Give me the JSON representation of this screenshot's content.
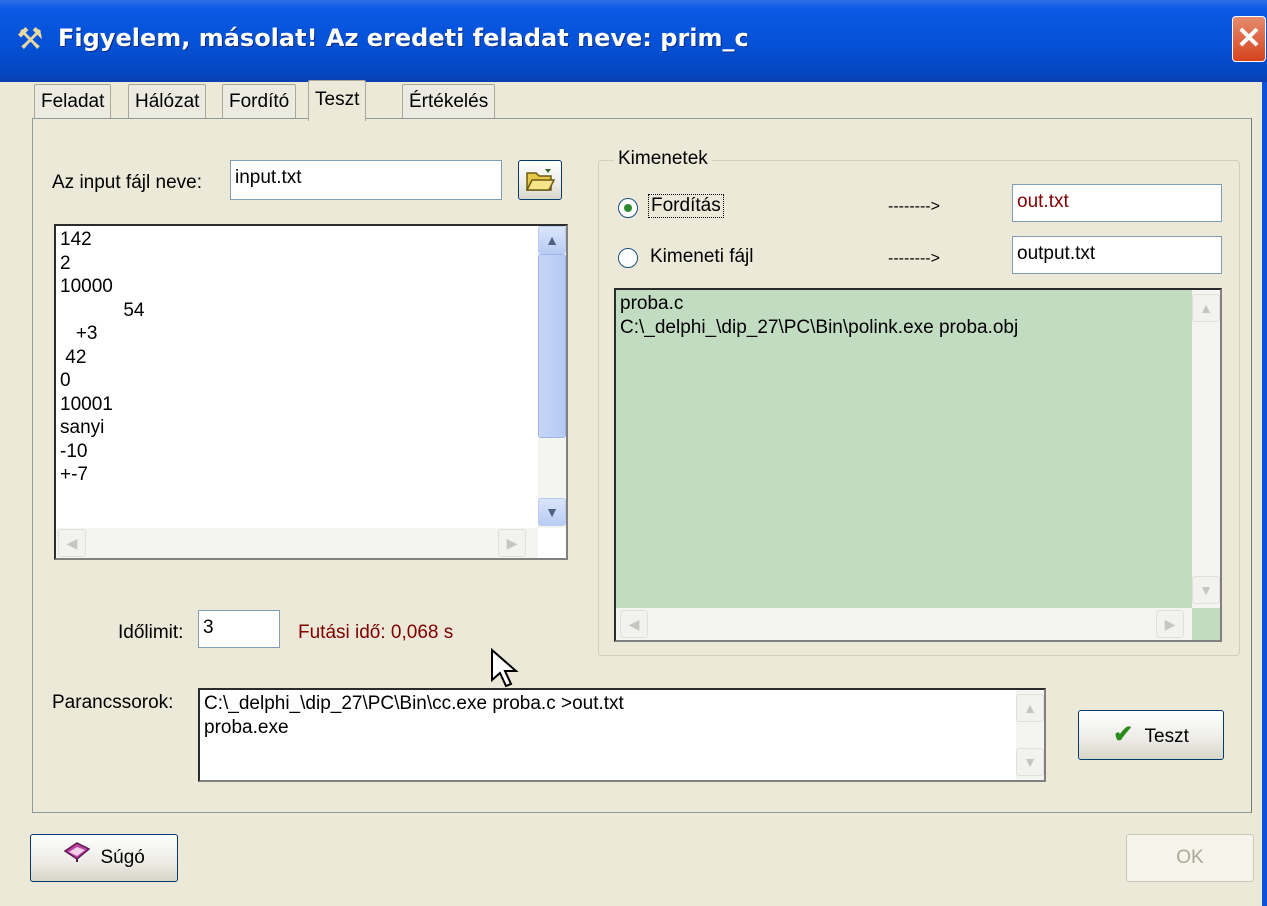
{
  "window": {
    "title": "Figyelem, másolat! Az eredeti feladat neve: prim_c",
    "title_icon": "tools-icon",
    "close_glyph": "✕"
  },
  "tabs": [
    {
      "label": "Feladat",
      "active": false
    },
    {
      "label": "Hálózat",
      "active": false
    },
    {
      "label": "Fordító",
      "active": false
    },
    {
      "label": "Teszt",
      "active": true
    },
    {
      "label": "Értékelés",
      "active": false
    }
  ],
  "input_file": {
    "label": "Az input fájl neve:",
    "value": "input.txt",
    "browse_icon": "folder-open-icon"
  },
  "input_memo": {
    "lines": "142\n2\n10000\n            54\n   +3\n 42\n0\n10001\nsanyi\n-10\n+-7"
  },
  "outputs": {
    "caption": "Kimenetek",
    "radio1_label": "Fordítás",
    "radio1_selected": true,
    "radio1_arrow": "-------->",
    "radio1_value": "out.txt",
    "radio2_label": "Kimeneti fájl",
    "radio2_selected": false,
    "radio2_arrow": "-------->",
    "radio2_value": "output.txt",
    "memo_lines": "proba.c\nC:\\_delphi_\\dip_27\\PC\\Bin\\polink.exe proba.obj",
    "memo_bg": "#c2dcc2"
  },
  "timelimit": {
    "label": "Időlimit:",
    "value": "3",
    "runtime": "Futási idő: 0,068 s",
    "runtime_color": "#800000"
  },
  "commands": {
    "label": "Parancssorok:",
    "lines": "C:\\_delphi_\\dip_27\\PC\\Bin\\cc.exe proba.c >out.txt\nproba.exe"
  },
  "buttons": {
    "test_label": "Teszt",
    "test_icon": "checkmark-icon",
    "help_label": "Súgó",
    "help_icon": "help-book-icon",
    "ok_label": "OK"
  }
}
